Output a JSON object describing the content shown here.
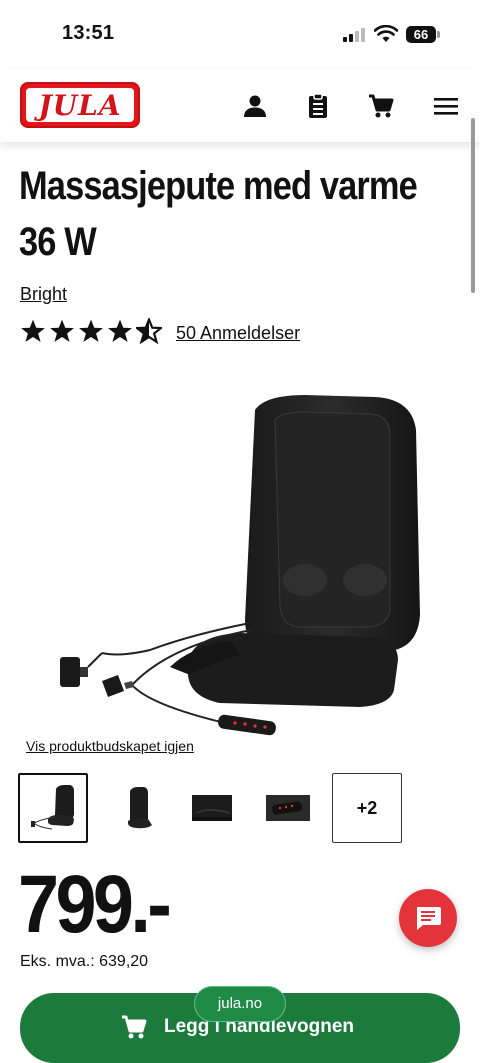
{
  "status_bar": {
    "time": "13:51",
    "battery": "66"
  },
  "header": {
    "logo_text": "JULA",
    "icons": [
      "user-icon",
      "shopping-list-icon",
      "cart-icon",
      "menu-icon"
    ]
  },
  "product": {
    "title": "Massasjepute med varme 36 W",
    "brand": "Bright",
    "rating": 4.5,
    "rating_max": 5,
    "reviews_label": "50 Anmeldelser",
    "image_link": "Vis produktbudskapet igjen",
    "thumbnails": [
      "seat-with-cables",
      "seat-side-view",
      "seat-cushion",
      "remote-control"
    ],
    "more_images": "+2",
    "price": "799.-",
    "price_ex_vat": "Eks. mva.: 639,20"
  },
  "actions": {
    "add_to_cart": "Legg i handlevognen"
  },
  "browser": {
    "url": "jula.no"
  },
  "colors": {
    "brand_red": "#e2161c",
    "cta_green": "#1c7a3d",
    "chat_red": "#e3333b"
  }
}
